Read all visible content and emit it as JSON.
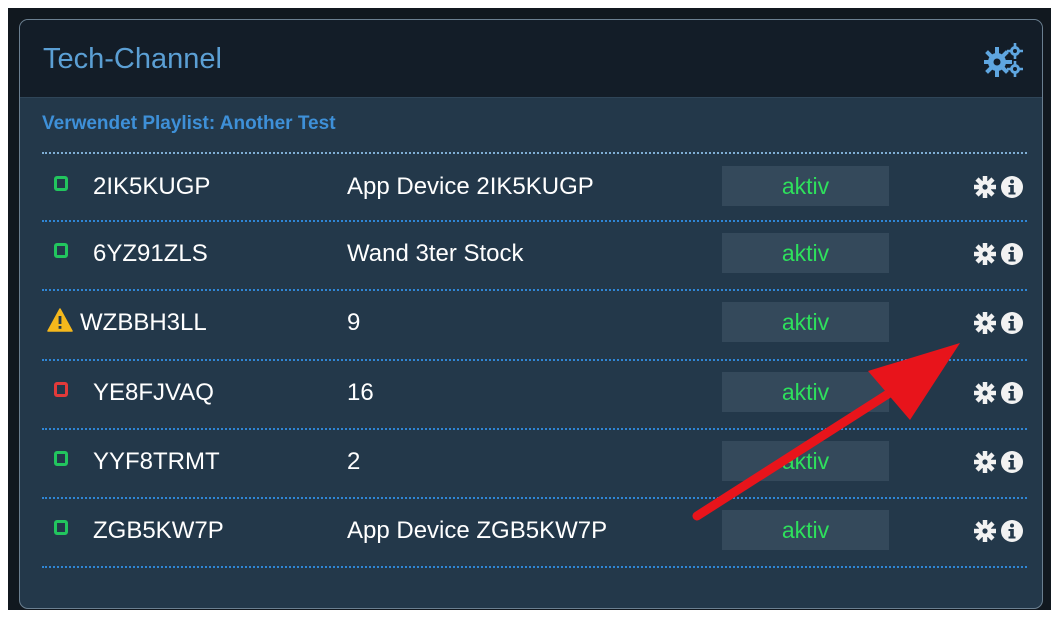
{
  "panel": {
    "title": "Tech-Channel",
    "playlist_text": "Verwendet Playlist: Another Test"
  },
  "devices": [
    {
      "id": "2IK5KUGP",
      "name": "App Device 2IK5KUGP",
      "status": "aktiv",
      "status_icon": "green-square-icon"
    },
    {
      "id": "6YZ91ZLS",
      "name": "Wand 3ter Stock",
      "status": "aktiv",
      "status_icon": "green-square-icon"
    },
    {
      "id": "WZBBH3LL",
      "name": "9",
      "status": "aktiv",
      "status_icon": "warning-triangle-icon"
    },
    {
      "id": "YE8FJVAQ",
      "name": "16",
      "status": "aktiv",
      "status_icon": "red-square-icon"
    },
    {
      "id": "YYF8TRMT",
      "name": "2",
      "status": "aktiv",
      "status_icon": "green-square-icon"
    },
    {
      "id": "ZGB5KW7P",
      "name": "App Device ZGB5KW7P",
      "status": "aktiv",
      "status_icon": "green-square-icon"
    }
  ],
  "colors": {
    "title": "#5b9fd4",
    "playlist": "#3e90d8",
    "status_text": "#2ee05c",
    "ok_icon": "#22c55e",
    "error_icon": "#e23a3a",
    "warning_icon": "#f5b81c",
    "annotation_arrow": "#e8141b"
  },
  "icons": {
    "header_settings": "gears-icon",
    "row_settings": "gear-icon",
    "row_info": "info-icon"
  }
}
